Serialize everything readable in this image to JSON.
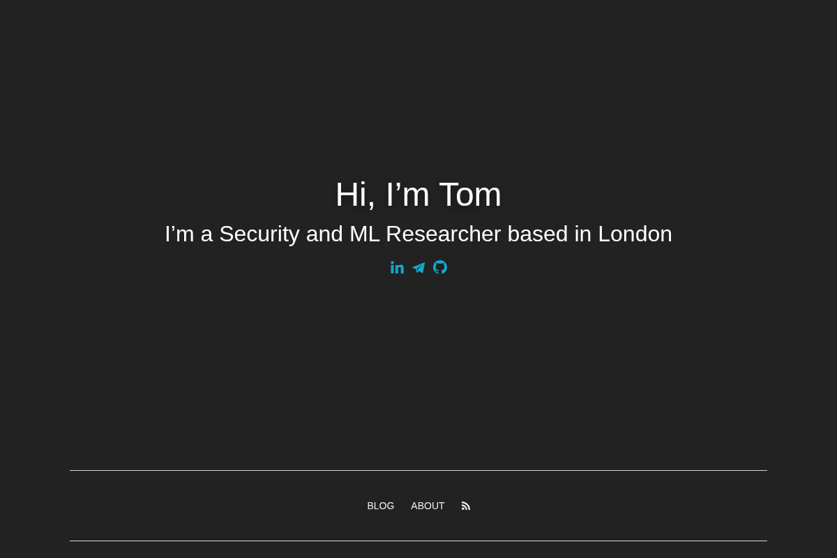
{
  "hero": {
    "title": "Hi, I’m Tom",
    "subtitle": "I’m a Security and ML Researcher based in London"
  },
  "social_links": [
    {
      "kind": "linkedin"
    },
    {
      "kind": "telegram"
    },
    {
      "kind": "github"
    }
  ],
  "footer_nav": [
    {
      "kind": "text",
      "label": "BLOG"
    },
    {
      "kind": "text",
      "label": "ABOUT"
    },
    {
      "kind": "rss"
    }
  ]
}
